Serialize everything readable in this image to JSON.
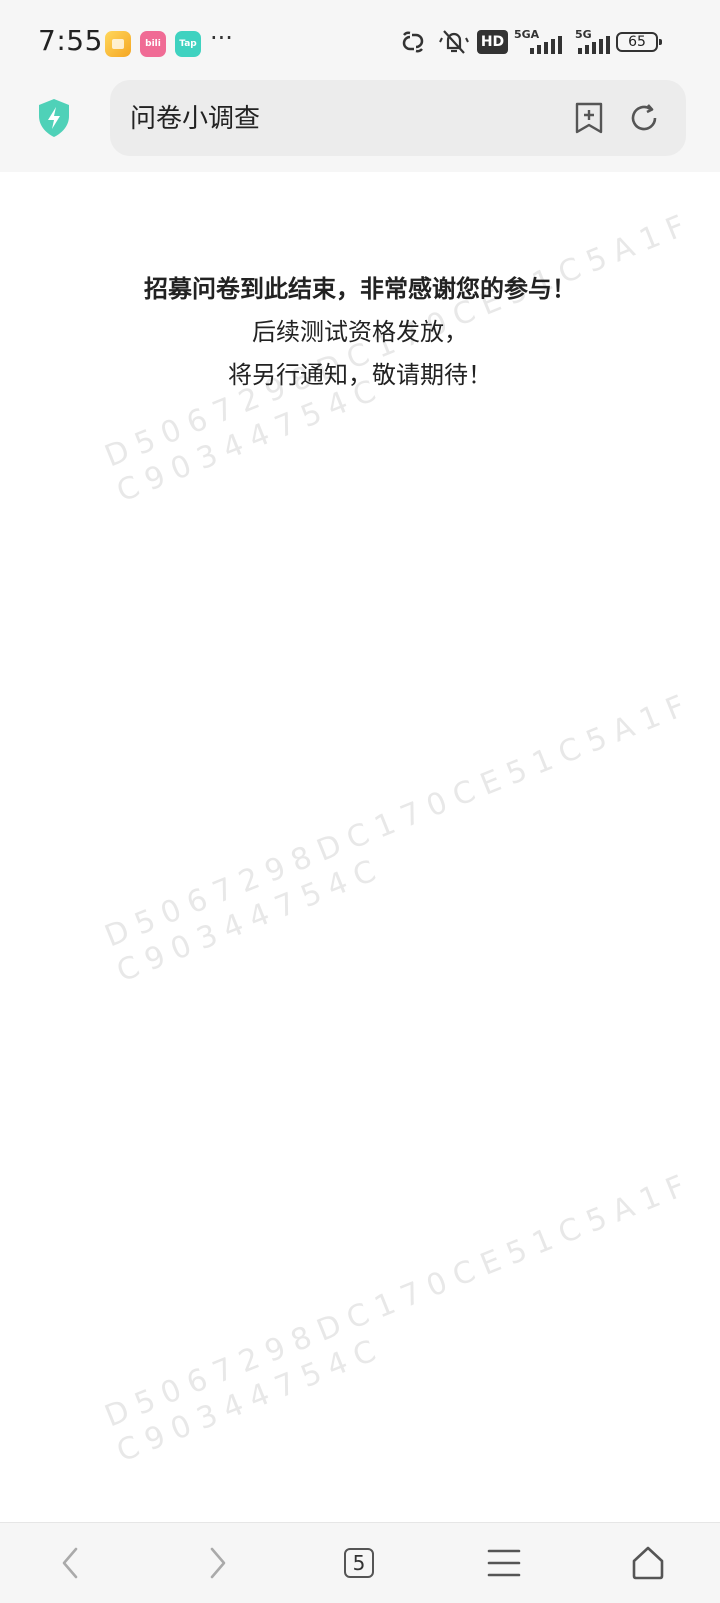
{
  "status_bar": {
    "time": "7:55",
    "apps": [
      "gallery-icon",
      "bilibili-icon",
      "taptap-icon"
    ],
    "bili_text": "bili",
    "tap_text": "Tap",
    "more": "···",
    "hd_label": "HD",
    "net1_label": "5GA",
    "net2_label": "5G",
    "battery": "65"
  },
  "browser": {
    "url_title": "问卷小调查"
  },
  "content": {
    "title": "招募问卷到此结束，非常感谢您的参与！",
    "line2": "后续测试资格发放，",
    "line3": "将另行通知，敬请期待！"
  },
  "watermark": {
    "line1": "D5067298DC170CE51C5A1F",
    "line2": "C90344754C"
  },
  "bottom_nav": {
    "tab_count": "5"
  },
  "colors": {
    "shield": "#4fd1b8",
    "background": "#ffffff",
    "bar": "#f6f6f6"
  }
}
